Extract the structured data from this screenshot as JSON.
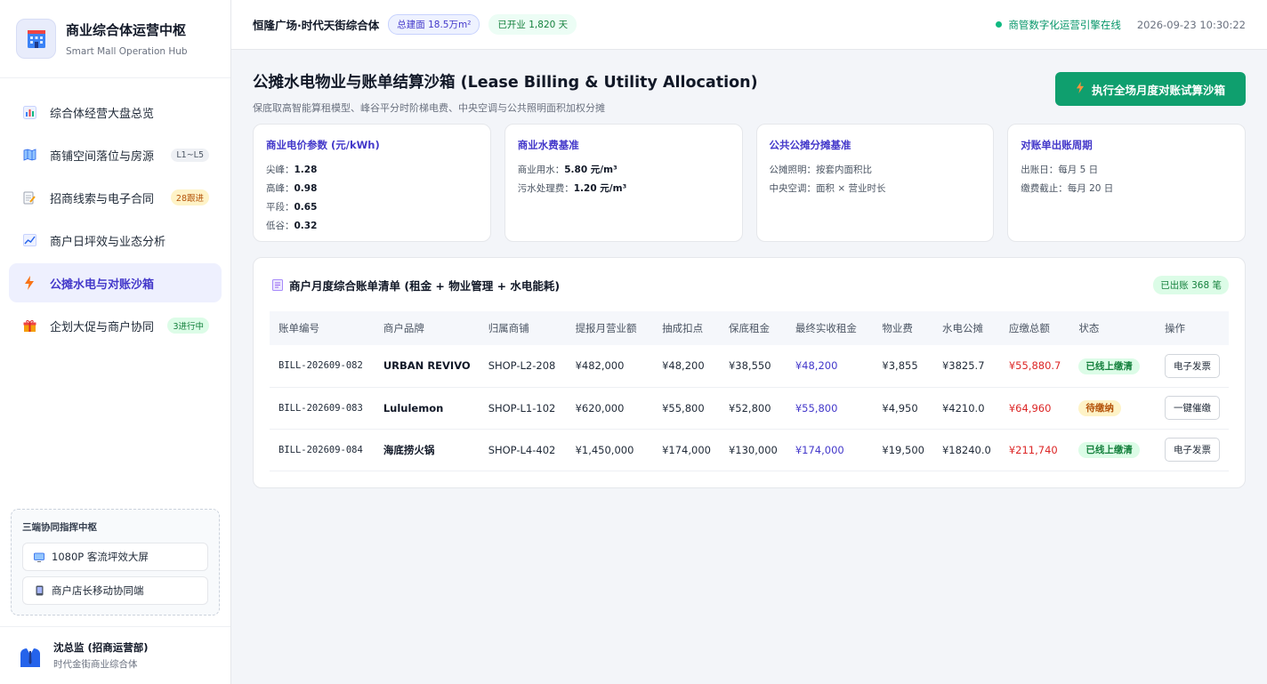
{
  "brand": {
    "title": "商业综合体运营中枢",
    "subtitle": "Smart Mall Operation Hub"
  },
  "nav": [
    {
      "label": "综合体经营大盘总览",
      "icon": "bar-chart-icon",
      "badge": ""
    },
    {
      "label": "商铺空间落位与房源",
      "icon": "map-icon",
      "badge": "L1~L5"
    },
    {
      "label": "招商线索与电子合同",
      "icon": "contract-icon",
      "badge": "28跟进"
    },
    {
      "label": "商户日坪效与业态分析",
      "icon": "line-chart-icon",
      "badge": ""
    },
    {
      "label": "公摊水电与对账沙箱",
      "icon": "bolt-icon",
      "badge": ""
    },
    {
      "label": "企划大促与商户协同",
      "icon": "gift-icon",
      "badge": "3进行中"
    }
  ],
  "hub": {
    "title": "三端协同指挥中枢",
    "screen_btn": "1080P 客流坪效大屏",
    "mobile_btn": "商户店长移动协同端"
  },
  "user": {
    "name": "沈总监 (招商运营部)",
    "org": "时代金街商业综合体"
  },
  "topbar": {
    "mall_name": "恒隆广场·时代天街综合体",
    "area_pill": "总建面 18.5万m²",
    "open_pill": "已开业 1,820 天",
    "status": "商管数字化运营引擎在线",
    "datetime": "2026-09-23 10:30:22"
  },
  "page": {
    "title": "公摊水电物业与账单结算沙箱 (Lease Billing & Utility Allocation)",
    "subtitle": "保底取高智能算租模型、峰谷平分时阶梯电费、中央空调与公共照明面积加权分摊",
    "cta": "执行全场月度对账试算沙箱"
  },
  "cards": {
    "electric": {
      "title": "商业电价参数 (元/kWh)",
      "rows": [
        {
          "k": "尖峰：",
          "v": "1.28"
        },
        {
          "k": "高峰：",
          "v": "0.98"
        },
        {
          "k": "平段：",
          "v": "0.65"
        },
        {
          "k": "低谷：",
          "v": "0.32"
        }
      ]
    },
    "water": {
      "title": "商业水费基准",
      "rows": [
        {
          "k": "商业用水：",
          "v": "5.80 元/m³"
        },
        {
          "k": "污水处理费：",
          "v": "1.20 元/m³"
        }
      ]
    },
    "share": {
      "title": "公共公摊分摊基准",
      "rows": [
        {
          "k": "公摊照明：按套内面积比",
          "v": ""
        },
        {
          "k": "中央空调：面积 × 营业时长",
          "v": ""
        }
      ]
    },
    "cycle": {
      "title": "对账单出账周期",
      "rows": [
        {
          "k": "出账日：每月 5 日",
          "v": ""
        },
        {
          "k": "缴费截止：每月 20 日",
          "v": ""
        }
      ]
    }
  },
  "table": {
    "title": "商户月度综合账单清单 (租金 + 物业管理 + 水电能耗)",
    "badge": "已出账 368 笔",
    "columns": [
      "账单编号",
      "商户品牌",
      "归属商铺",
      "提报月营业额",
      "抽成扣点",
      "保底租金",
      "最终实收租金",
      "物业费",
      "水电公摊",
      "应缴总额",
      "状态",
      "操作"
    ],
    "rows": [
      {
        "id": "BILL-202609-082",
        "brand": "URBAN REVIVO",
        "shop": "SHOP-L2-208",
        "revenue": "¥482,000",
        "commission": "¥48,200",
        "base_rent": "¥38,550",
        "final_rent": "¥48,200",
        "property": "¥3,855",
        "utility": "¥3825.7",
        "total": "¥55,880.7",
        "status": "已线上缴清",
        "status_type": "green",
        "action": "电子发票"
      },
      {
        "id": "BILL-202609-083",
        "brand": "Lululemon",
        "shop": "SHOP-L1-102",
        "revenue": "¥620,000",
        "commission": "¥55,800",
        "base_rent": "¥52,800",
        "final_rent": "¥55,800",
        "property": "¥4,950",
        "utility": "¥4210.0",
        "total": "¥64,960",
        "status": "待缴纳",
        "status_type": "yellow",
        "action": "一键催缴"
      },
      {
        "id": "BILL-202609-084",
        "brand": "海底捞火锅",
        "shop": "SHOP-L4-402",
        "revenue": "¥1,450,000",
        "commission": "¥174,000",
        "base_rent": "¥130,000",
        "final_rent": "¥174,000",
        "property": "¥19,500",
        "utility": "¥18240.0",
        "total": "¥211,740",
        "status": "已线上缴清",
        "status_type": "green",
        "action": "电子发票"
      }
    ]
  },
  "colors": {
    "accent": "#4338ca",
    "cta": "#0f9f6e",
    "danger": "#dc2626",
    "success": "#15803d"
  }
}
